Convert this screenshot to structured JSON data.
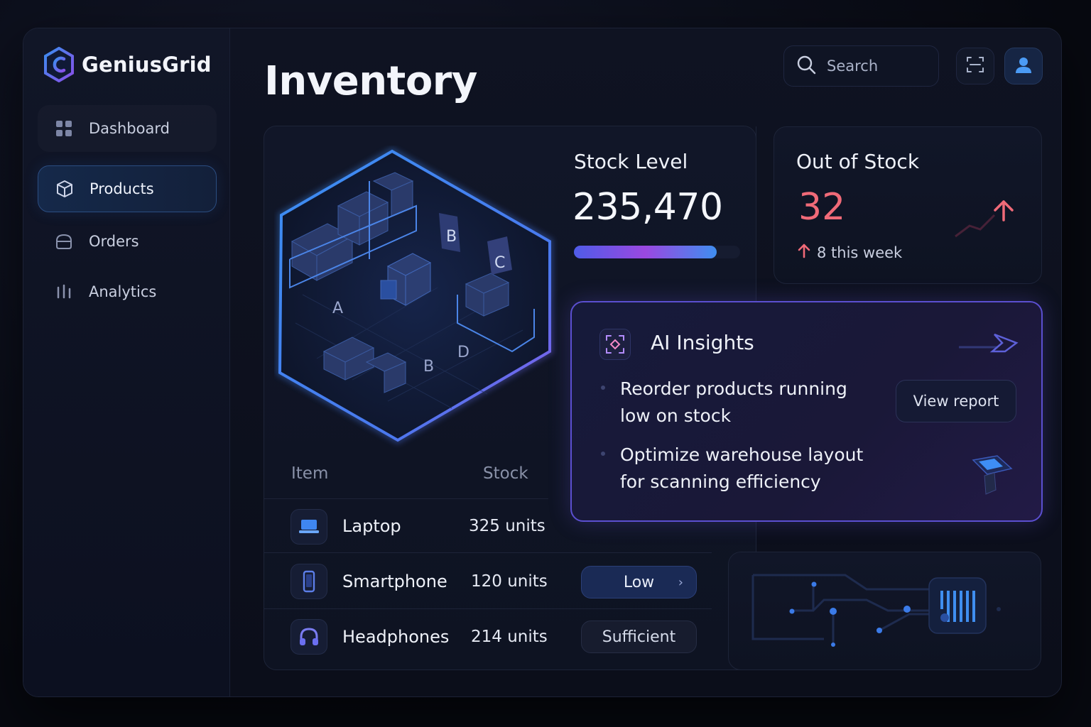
{
  "app": {
    "name": "GeniusGrid"
  },
  "sidebar": {
    "items": [
      {
        "label": "Dashboard",
        "icon": "grid-icon"
      },
      {
        "label": "Products",
        "icon": "box-icon",
        "active": true
      },
      {
        "label": "Orders",
        "icon": "bag-icon"
      },
      {
        "label": "Analytics",
        "icon": "bars-icon"
      }
    ]
  },
  "header": {
    "title": "Inventory",
    "search_placeholder": "Search"
  },
  "warehouse_labels": {
    "a": "A",
    "b_top": "B",
    "c": "C",
    "b_bottom": "B",
    "d": "D"
  },
  "stock_level": {
    "title": "Stock Level",
    "value": "235,470",
    "progress": 0.86
  },
  "out_of_stock": {
    "title": "Out of Stock",
    "value": "32",
    "change": "8 this week"
  },
  "ai_insights": {
    "title": "AI Insights",
    "items": [
      "Reorder products running low on stock",
      "Optimize warehouse layout for scanning efficiency"
    ],
    "button_label": "View report"
  },
  "table": {
    "headers": {
      "item": "Item",
      "stock": "Stock"
    },
    "rows": [
      {
        "name": "Laptop",
        "stock": "325 units",
        "status": "",
        "icon": "laptop-icon"
      },
      {
        "name": "Smartphone",
        "stock": "120 units",
        "status": "Low",
        "icon": "smartphone-icon"
      },
      {
        "name": "Headphones",
        "stock": "214 units",
        "status": "Sufficient",
        "icon": "headphones-icon"
      }
    ]
  },
  "colors": {
    "accent": "#3f8ef0",
    "purple": "#8a4fe8",
    "alert": "#f06a78",
    "background": "#0b0e1a"
  }
}
